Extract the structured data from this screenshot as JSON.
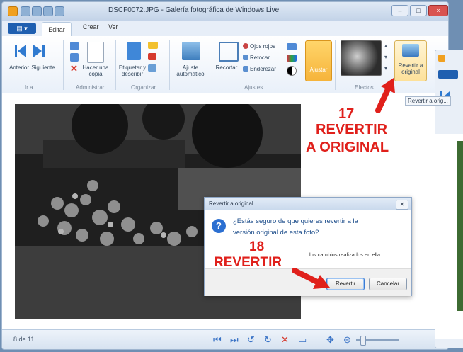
{
  "window": {
    "title": "DSCF0072.JPG - Galería fotográfica de Windows Live",
    "tabs": [
      "Editar",
      "Crear",
      "Ver"
    ],
    "file_menu": ""
  },
  "ribbon": {
    "groups": {
      "ir": {
        "label": "Ir a",
        "buttons": [
          "Anterior",
          "Siguiente"
        ]
      },
      "administrar": {
        "label": "Administrar",
        "buttons": [
          "Hacer una copia"
        ]
      },
      "organizar": {
        "label": "Organizar",
        "buttons": [
          "Etiquetar y describir"
        ]
      },
      "ajustes": {
        "label": "Ajustes",
        "buttons": [
          "Ajuste automático",
          "Recortar",
          "Ojos rojos",
          "Retocar",
          "Enderezar",
          "Ajustar"
        ]
      },
      "efectos": {
        "label": "Efectos",
        "buttons": []
      }
    },
    "revertir": {
      "label": "Revertir a original"
    },
    "tooltip": "Revertir a orig..."
  },
  "status": {
    "page_indicator": "8 de 11"
  },
  "callouts": {
    "step17_number": "17",
    "step17_line1": "REVERTIR",
    "step17_line2": "A ORIGINAL",
    "step18_number": "18",
    "step18_text": "REVERTIR"
  },
  "dialog": {
    "title": "Revertir a original",
    "message_line1": "¿Estás seguro de que quieres revertir a la",
    "message_line2": "versión original de esta foto?",
    "note": "los cambios realizados en ella",
    "revertir_button": "Revertir",
    "cancelar_button": "Cancelar"
  },
  "colors": {
    "accent": "#e0201b",
    "brand_blue": "#1f5fb0"
  }
}
